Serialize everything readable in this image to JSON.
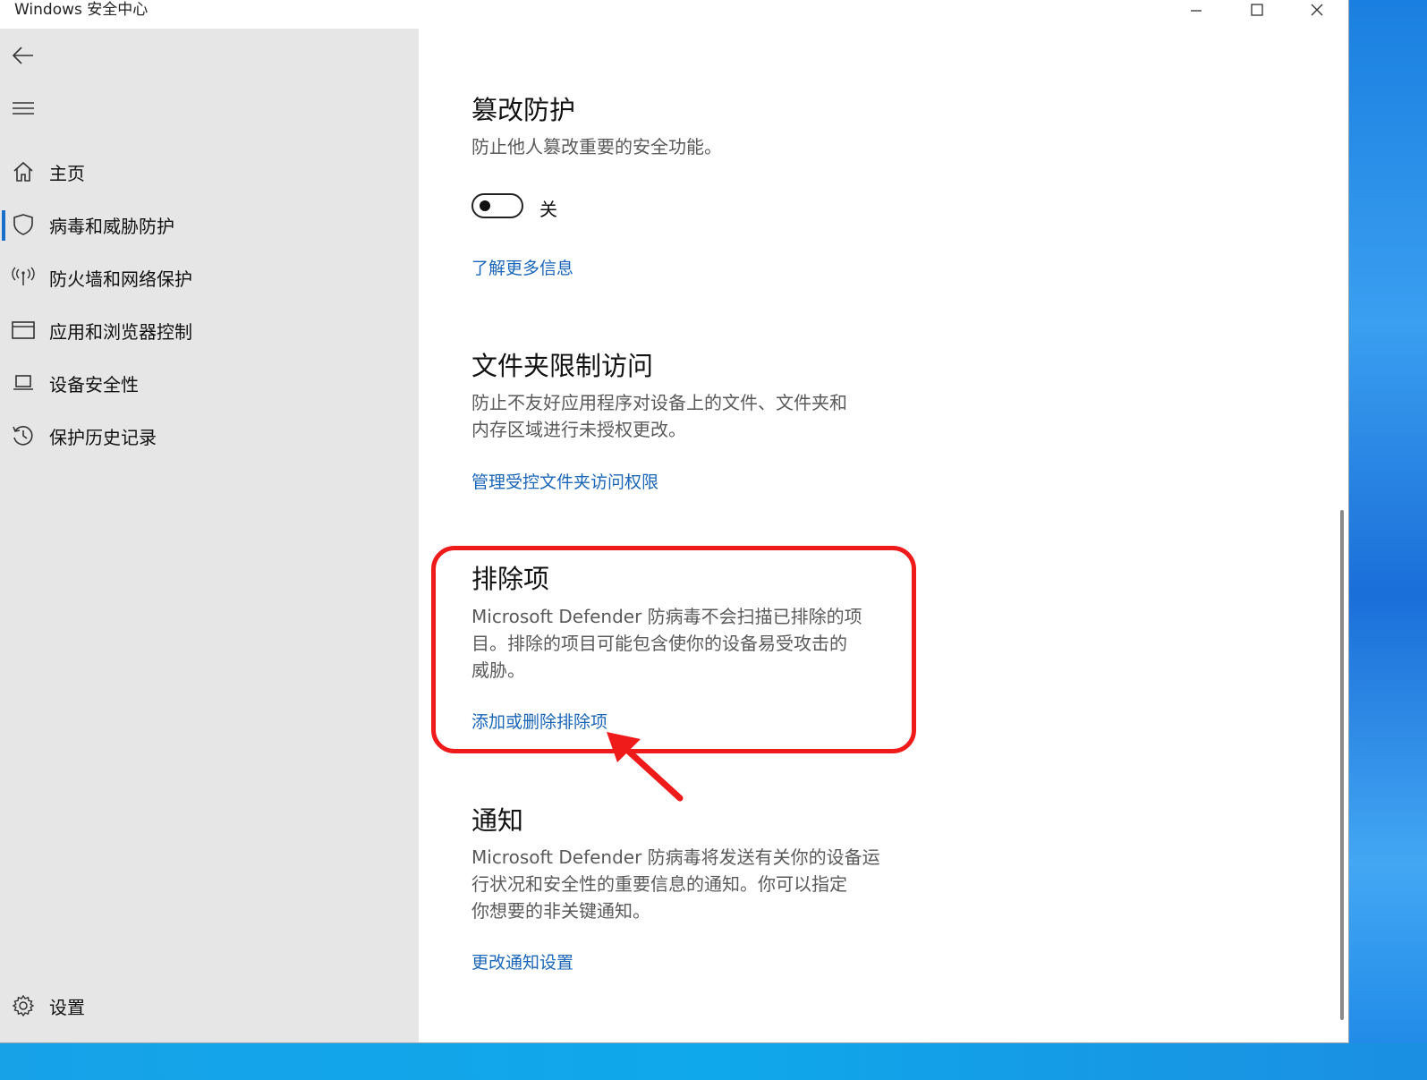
{
  "window": {
    "title": "Windows 安全中心"
  },
  "title_controls": {
    "minimize_icon": "minimize-icon",
    "maximize_icon": "maximize-icon",
    "close_icon": "close-icon"
  },
  "sidebar": {
    "back_icon": "back-arrow-icon",
    "menu_icon": "hamburger-menu-icon",
    "items": [
      {
        "label": "主页",
        "icon": "home-icon"
      },
      {
        "label": "病毒和威胁防护",
        "icon": "shield-icon",
        "active": true
      },
      {
        "label": "防火墙和网络保护",
        "icon": "wireless-signal-icon"
      },
      {
        "label": "应用和浏览器控制",
        "icon": "browser-window-icon"
      },
      {
        "label": "设备安全性",
        "icon": "laptop-icon"
      },
      {
        "label": "保护历史记录",
        "icon": "history-icon"
      }
    ],
    "settings": {
      "label": "设置",
      "icon": "gear-icon"
    }
  },
  "sections": {
    "tamper": {
      "title": "篡改防护",
      "desc": "防止他人篡改重要的安全功能。",
      "toggle_state": "关",
      "link": "了解更多信息"
    },
    "folder": {
      "title": "文件夹限制访问",
      "desc_line1": "防止不友好应用程序对设备上的文件、文件夹和",
      "desc_line2": "内存区域进行未授权更改。",
      "link": "管理受控文件夹访问权限"
    },
    "exclusions": {
      "title": "排除项",
      "desc_line1": "Microsoft Defender 防病毒不会扫描已排除的项",
      "desc_line2": "目。排除的项目可能包含使你的设备易受攻击的",
      "desc_line3": "威胁。",
      "link": "添加或删除排除项"
    },
    "notifications": {
      "title": "通知",
      "desc_line1": "Microsoft Defender 防病毒将发送有关你的设备运",
      "desc_line2": "行状况和安全性的重要信息的通知。你可以指定",
      "desc_line3": "你想要的非关键通知。",
      "link": "更改通知设置"
    }
  },
  "colors": {
    "link": "#1a66b8",
    "highlight": "#ef1b1b",
    "active_indicator": "#1a6fc8"
  }
}
